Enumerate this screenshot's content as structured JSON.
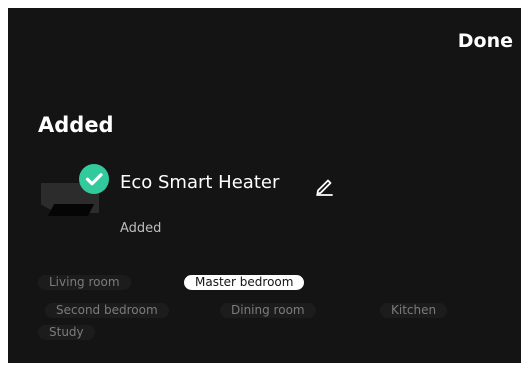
{
  "header": {
    "done_label": "Done"
  },
  "section": {
    "title": "Added"
  },
  "device": {
    "name": "Eco Smart Heater",
    "status": "Added",
    "badge_icon": "check-icon",
    "edit_icon": "pencil-icon"
  },
  "rooms": [
    {
      "label": "Living room",
      "selected": false
    },
    {
      "label": "Master bedroom",
      "selected": true
    },
    {
      "label": "Second bedroom",
      "selected": false
    },
    {
      "label": "Dining room",
      "selected": false
    },
    {
      "label": "Kitchen",
      "selected": false
    },
    {
      "label": "Study",
      "selected": false
    }
  ],
  "colors": {
    "background": "#141414",
    "accent": "#32c99c",
    "chip": "#1c1c1c",
    "chip_selected": "#ffffff"
  }
}
